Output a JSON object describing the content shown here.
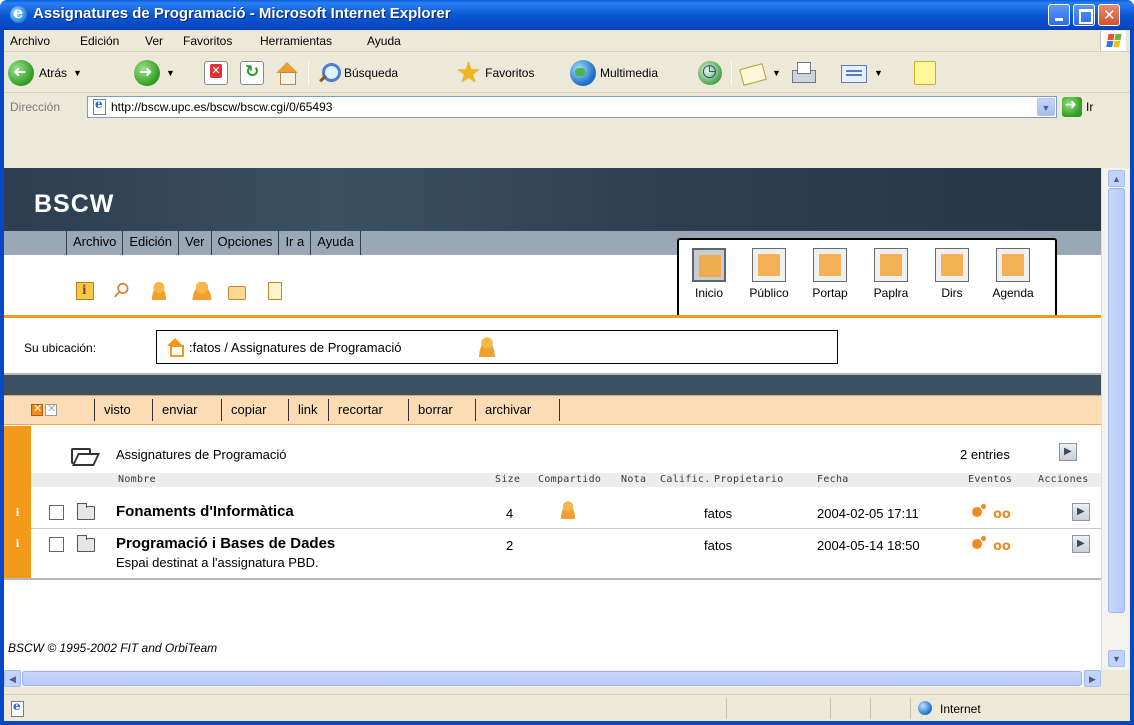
{
  "window": {
    "title": "Assignatures de Programació - Microsoft Internet Explorer"
  },
  "menubar": {
    "items": [
      "Archivo",
      "Edición",
      "Ver",
      "Favoritos",
      "Herramientas",
      "Ayuda"
    ]
  },
  "toolbar": {
    "back": "Atrás",
    "search": "Búsqueda",
    "favorites": "Favoritos",
    "media": "Multimedia"
  },
  "address": {
    "label": "Dirección",
    "url": "http://bscw.upc.es/bscw/bscw.cgi/0/65493",
    "go": "Ir"
  },
  "bscw": {
    "logo": "BSCW",
    "menu": [
      "Archivo",
      "Edición",
      "Ver",
      "Opciones",
      "Ir a",
      "Ayuda"
    ],
    "nav": [
      "Inicio",
      "Público",
      "Portap",
      "Paplra",
      "Dirs",
      "Agenda"
    ],
    "location_label": "Su ubicación:",
    "location_path": ":fatos / Assignatures de Programació",
    "actions": [
      "visto",
      "enviar",
      "copiar",
      "link",
      "recortar",
      "borrar",
      "archivar"
    ],
    "folder_title": "Assignatures de Programació",
    "entries": "2 entries",
    "columns": {
      "name": "Nombre",
      "size": "Size",
      "shared": "Compartido",
      "note": "Nota",
      "rating": "Calific.",
      "owner": "Propietario",
      "date": "Fecha",
      "events": "Eventos",
      "actions": "Acciones"
    },
    "rows": [
      {
        "info": "i",
        "name": "Fonaments d'Informàtica",
        "size": "4",
        "owner": "fatos",
        "date": "2004-02-05 17:11",
        "desc": ""
      },
      {
        "info": "i",
        "name": "Programació i Bases de Dades",
        "size": "2",
        "owner": "fatos",
        "date": "2004-05-14 18:50",
        "desc": "Espai destinat a l'assignatura PBD."
      }
    ],
    "footer": "BSCW © 1995-2002 FIT and OrbiTeam"
  },
  "status": {
    "zone": "Internet"
  },
  "colors": {
    "titlebar": "#0a4fd0",
    "bscw_header": "#2d4051",
    "accent_orange": "#f39a1c",
    "action_bar": "#fbdcb4"
  }
}
